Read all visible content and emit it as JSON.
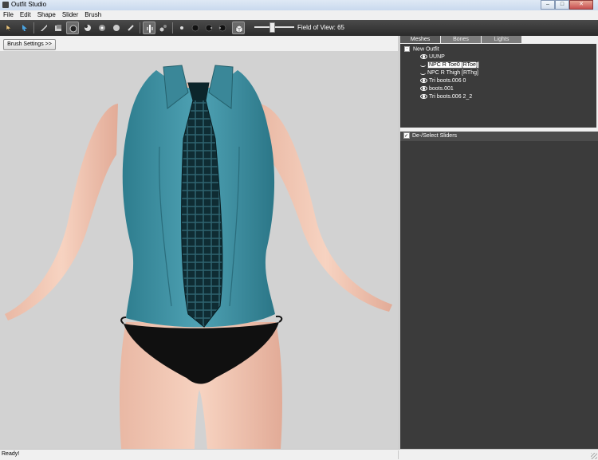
{
  "window": {
    "title": "Outfit Studio",
    "minimize": "–",
    "maximize": "□",
    "close": "✕"
  },
  "menu": [
    "File",
    "Edit",
    "Shape",
    "Slider",
    "Brush"
  ],
  "toolbar": {
    "tools": [
      "select-tool",
      "transform-tool",
      "mask-brush",
      "inflate-brush",
      "deflate-brush",
      "move-brush",
      "smooth-brush",
      "weight-brush",
      "color-brush",
      "x-mirror-toggle",
      "connected-only-toggle",
      "brush-size-1",
      "brush-size-2",
      "brush-size-3",
      "brush-size-4",
      "wireframe-toggle"
    ],
    "fov_label": "Field of View: 65",
    "fov_value": 65
  },
  "brush_settings_button": "Brush Settings >>",
  "mesh_tabs": [
    "Meshes",
    "Bones",
    "Lights"
  ],
  "active_tab": "Meshes",
  "mesh_tree": {
    "root": "New Outfit",
    "expander": "-",
    "items": [
      {
        "label": "UUNP",
        "visible": true,
        "selected": false
      },
      {
        "label": "NPC R Toe0 [RToe]",
        "visible": false,
        "selected": true
      },
      {
        "label": "NPC R Thigh [RThg]",
        "visible": false,
        "selected": false
      },
      {
        "label": "Tri boots.006 0",
        "visible": true,
        "selected": false
      },
      {
        "label": "boots.001",
        "visible": true,
        "selected": false
      },
      {
        "label": "Tri boots.006 2_2",
        "visible": true,
        "selected": false
      }
    ]
  },
  "sliders_panel": {
    "header": "De-/Select Sliders",
    "checked": true
  },
  "status": {
    "text": "Ready!"
  },
  "colors": {
    "viewport": "#d2d2d2",
    "panel_dark": "#3b3b3b",
    "toolbar": "#333333",
    "top": "#3d8a9c",
    "tie": "#12333a",
    "skin": "#f2c8b2"
  }
}
